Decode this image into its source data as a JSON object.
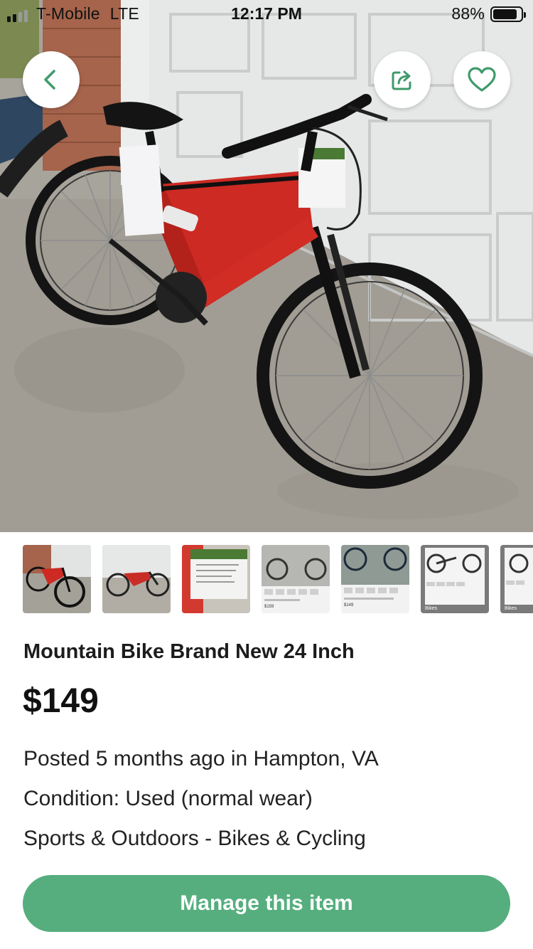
{
  "status_bar": {
    "carrier": "T-Mobile",
    "network": "LTE",
    "time": "12:17 PM",
    "battery": "88%",
    "battery_level": 0.88
  },
  "header": {
    "back_icon": "chevron-left-icon",
    "share_icon": "share-icon",
    "favorite_icon": "heart-icon"
  },
  "gallery": {
    "thumbnail_count": 7,
    "thumbnails": [
      {
        "caption": "",
        "price": ""
      },
      {
        "caption": "",
        "price": ""
      },
      {
        "caption": "",
        "price": ""
      },
      {
        "caption": "",
        "price": "$159"
      },
      {
        "caption": "",
        "price": "$149"
      },
      {
        "caption": "Bikes",
        "price": ""
      },
      {
        "caption": "Bikes",
        "price": ""
      }
    ]
  },
  "listing": {
    "title": "Mountain Bike Brand New 24 Inch",
    "price": "$149",
    "posted": "Posted 5 months ago in Hampton, VA",
    "condition": "Condition: Used (normal wear)",
    "category": "Sports & Outdoors - Bikes & Cycling"
  },
  "actions": {
    "manage_label": "Manage this item"
  },
  "colors": {
    "accent": "#56ae7e",
    "icon_green": "#3f9a6b"
  }
}
